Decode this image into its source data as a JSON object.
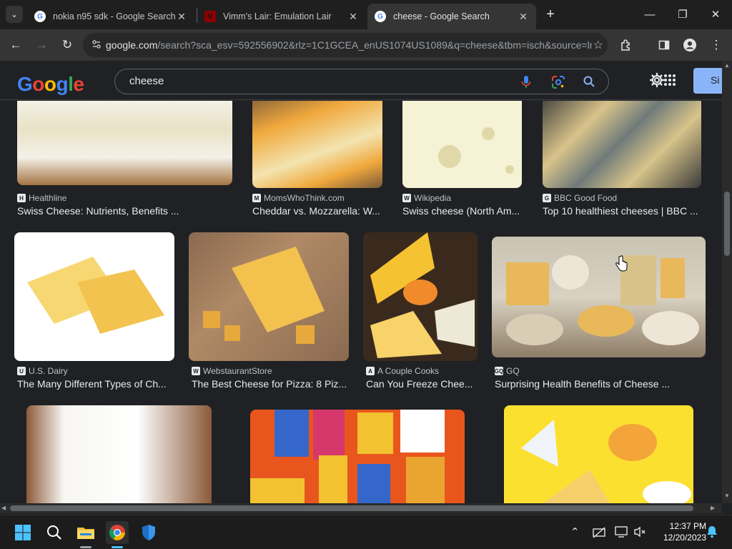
{
  "browser": {
    "tabs": [
      {
        "title": "nokia n95 sdk - Google Search",
        "favicon": "google-g-icon",
        "active": false
      },
      {
        "title": "Vimm's Lair: Emulation Lair",
        "favicon": "vimm-v-icon",
        "active": false
      },
      {
        "title": "cheese - Google Search",
        "favicon": "google-g-icon",
        "active": true
      }
    ],
    "url_domain": "google.com",
    "url_rest": "/search?sca_esv=592556902&rlz=1C1GCEA_enUS1074US1089&q=cheese&tbm=isch&source=ln..."
  },
  "search": {
    "logo_letters": [
      "G",
      "o",
      "o",
      "g",
      "l",
      "e"
    ],
    "logo_colors": [
      "#4285f4",
      "#ea4335",
      "#fbbc05",
      "#4285f4",
      "#34a853",
      "#ea4335"
    ],
    "query": "cheese",
    "signin_label": "Si"
  },
  "results": [
    {
      "source": "Healthline",
      "title": "Swiss Cheese: Nutrients, Benefits ...",
      "icon": "healthline-icon",
      "colors": [
        "#f4f1e8",
        "#e9e2c6",
        "#a47443"
      ]
    },
    {
      "source": "MomsWhoThink.com",
      "title": "Cheddar vs. Mozzarella: W...",
      "icon": "momswhothink-icon",
      "colors": [
        "#f0a83c",
        "#f3e4b0",
        "#7a5a3a"
      ]
    },
    {
      "source": "Wikipedia",
      "title": "Swiss cheese (North Am...",
      "icon": "wikipedia-w-icon",
      "colors": [
        "#f6f2d6",
        "#efe8b8",
        "#ffffff"
      ]
    },
    {
      "source": "BBC Good Food",
      "title": "Top 10 healthiest cheeses | BBC ...",
      "icon": "bbc-goodfood-icon",
      "colors": [
        "#3a3a3a",
        "#d8c38a",
        "#6f7a78"
      ]
    },
    {
      "source": "U.S. Dairy",
      "title": "The Many Different Types of Ch...",
      "icon": "usdairy-icon",
      "colors": [
        "#ffffff",
        "#f7d772",
        "#f2c34f"
      ]
    },
    {
      "source": "WebstaurantStore",
      "title": "The Best Cheese for Pizza: 8 Piz...",
      "icon": "webstaurant-icon",
      "colors": [
        "#f2c14e",
        "#8a6a50",
        "#e7a93b"
      ]
    },
    {
      "source": "A Couple Cooks",
      "title": "Can You Freeze Chee...",
      "icon": "acouplecooks-icon",
      "colors": [
        "#f5c232",
        "#3a2a1e",
        "#f08a2a"
      ]
    },
    {
      "source": "GQ",
      "title": "Surprising Health Benefits of Cheese ...",
      "icon": "gq-icon",
      "colors": [
        "#d9d2c2",
        "#e8b85a",
        "#8e7d66"
      ]
    },
    {
      "source": "",
      "title": "",
      "icon": "",
      "colors": [
        "#f7f6f1",
        "#8b5a3a",
        "#ffffff"
      ]
    },
    {
      "source": "",
      "title": "",
      "icon": "",
      "colors": [
        "#e9561d",
        "#f2c230",
        "#3467c9"
      ]
    },
    {
      "source": "",
      "title": "",
      "icon": "",
      "colors": [
        "#fce030",
        "#f5d06a",
        "#ffffff"
      ]
    }
  ],
  "taskbar": {
    "time": "12:37 PM",
    "date": "12/20/2023"
  }
}
